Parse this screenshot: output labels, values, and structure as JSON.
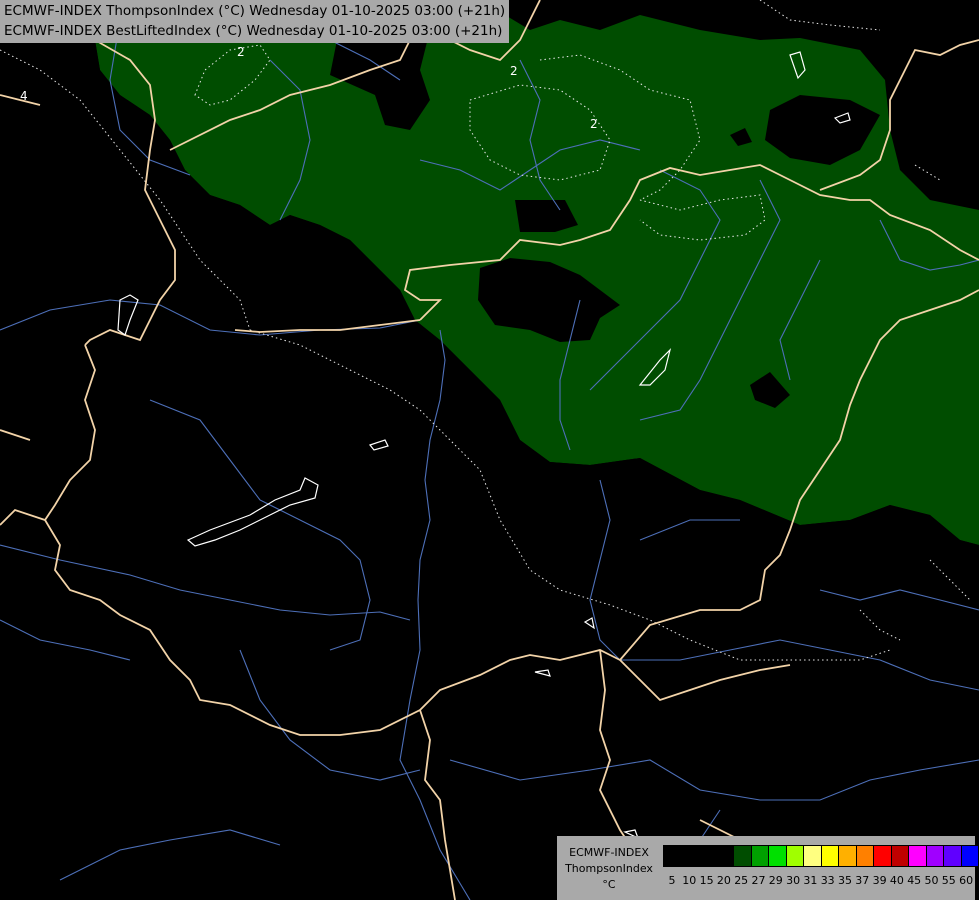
{
  "title": {
    "line1": "ECMWF-INDEX ThompsonIndex (°C) Wednesday 01-10-2025 03:00 (+21h)",
    "line2": "ECMWF-INDEX BestLiftedIndex (°C) Wednesday 01-10-2025 03:00 (+21h)"
  },
  "map": {
    "contour_labels": [
      "2",
      "2",
      "2",
      "4"
    ],
    "fill_color": "#004d00",
    "border_color": "#f2d3a8",
    "river_color": "#4d6fb8",
    "lake_outline_color": "#ffffff"
  },
  "legend": {
    "line1": "ECMWF-INDEX",
    "line2": "ThompsonIndex",
    "line3": "°C",
    "ticks": [
      "5",
      "10",
      "15",
      "20",
      "25",
      "27",
      "29",
      "30",
      "31",
      "33",
      "35",
      "37",
      "39",
      "40",
      "45",
      "50",
      "55",
      "60"
    ],
    "colors": [
      "#000000",
      "#000000",
      "#000000",
      "#000000",
      "#004d00",
      "#00a000",
      "#00e000",
      "#a0ff00",
      "#ffff80",
      "#ffff00",
      "#ffb000",
      "#ff8000",
      "#ff0000",
      "#c00000",
      "#ff00ff",
      "#a000ff",
      "#6000ff",
      "#0000ff"
    ]
  }
}
